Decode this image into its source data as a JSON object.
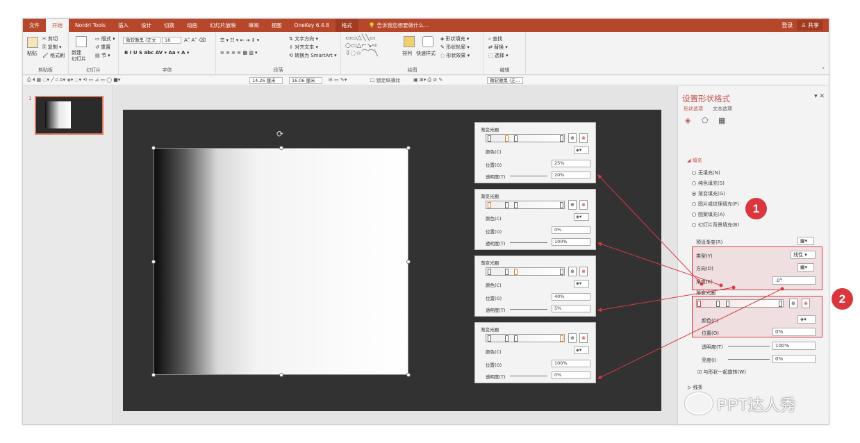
{
  "menubar": {
    "tabs": [
      "文件",
      "开始",
      "Nordri Tools",
      "插入",
      "设计",
      "切换",
      "动画",
      "幻灯片放映",
      "审阅",
      "视图",
      "OneKey 6.4.8",
      "格式"
    ],
    "tell_me": "告诉我您想要做什么...",
    "login": "登录",
    "share": "共享"
  },
  "ribbon": {
    "clipboard": {
      "label": "剪贴板",
      "paste": "粘贴",
      "cut": "剪切",
      "copy": "复制 ▾",
      "format_painter": "格式刷"
    },
    "slides": {
      "label": "幻灯片",
      "new_slide": "新建\n幻灯片",
      "layout": "版式 ▾",
      "reset": "重置",
      "section": "节 ▾"
    },
    "font": {
      "label": "字体",
      "font_name": "微软雅黑 (正文",
      "font_size": "18",
      "row2": "B  I  U  S  abc  AV ▾  Aa ▾   A ▾"
    },
    "paragraph": {
      "label": "段落",
      "text_direction": "文字方向 ▾",
      "align_text": "对齐文本 ▾",
      "smartart": "转换为 SmartArt ▾"
    },
    "drawing": {
      "label": "绘图",
      "arrange": "排列",
      "quick_styles": "快速样式",
      "shape_fill": "形状填充 ▾",
      "shape_outline": "形状轮廓 ▾",
      "shape_effects": "形状效果 ▾"
    },
    "editing": {
      "label": "编辑",
      "find": "查找",
      "replace": "替换 ▾",
      "select": "选择 ▾"
    }
  },
  "quickbar": {
    "width": "14.26 厘米",
    "height": "16.06 厘米",
    "lock_ratio": "锁定纵横比",
    "font": "微软雅黑 (正..."
  },
  "thumbs": {
    "slide_number": "1"
  },
  "panels": [
    {
      "title": "渐变光圈",
      "color_label": "颜色(C)",
      "position_label": "位置(O)",
      "position": "25%",
      "transparency_label": "透明度(T)",
      "transparency": "20%"
    },
    {
      "title": "渐变光圈",
      "color_label": "颜色(C)",
      "position_label": "位置(O)",
      "position": "0%",
      "transparency_label": "透明度(T)",
      "transparency": "100%"
    },
    {
      "title": "渐变光圈",
      "color_label": "颜色(C)",
      "position_label": "位置(O)",
      "position": "40%",
      "transparency_label": "透明度(T)",
      "transparency": "5%"
    },
    {
      "title": "渐变光圈",
      "color_label": "颜色(C)",
      "position_label": "位置(O)",
      "position": "100%",
      "transparency_label": "透明度(T)",
      "transparency": "0%"
    }
  ],
  "format_pane": {
    "title": "设置形状格式",
    "tab_shape": "形状选项",
    "tab_text": "文本选项",
    "fill_header": "填充",
    "fill_options": [
      "无填充(N)",
      "纯色填充(S)",
      "渐变填充(G)",
      "图片或纹理填充(P)",
      "图案填充(A)",
      "幻灯片背景填充(B)"
    ],
    "selected_fill": 2,
    "preset_label": "预设渐变(R)",
    "type_label": "类型(Y)",
    "type_value": "线性",
    "direction_label": "方向(D)",
    "angle_label": "角度(E)",
    "angle_value": ".0°",
    "stops_label": "渐变光圈",
    "color_label": "颜色(C)",
    "position_label": "位置(O)",
    "position_value": "0%",
    "transparency_label": "透明度(T)",
    "transparency_value": "100%",
    "brightness_label": "亮度(I)",
    "brightness_value": "0%",
    "rotate_with_shape": "与形状一起旋转(W)",
    "line_header": "线条"
  },
  "annotations": {
    "badge1": "1",
    "badge2": "2"
  },
  "watermark": "PPT达人秀",
  "colors": {
    "accent": "#b7472a",
    "highlight": "#d63a44",
    "badge": "#d9363e"
  }
}
